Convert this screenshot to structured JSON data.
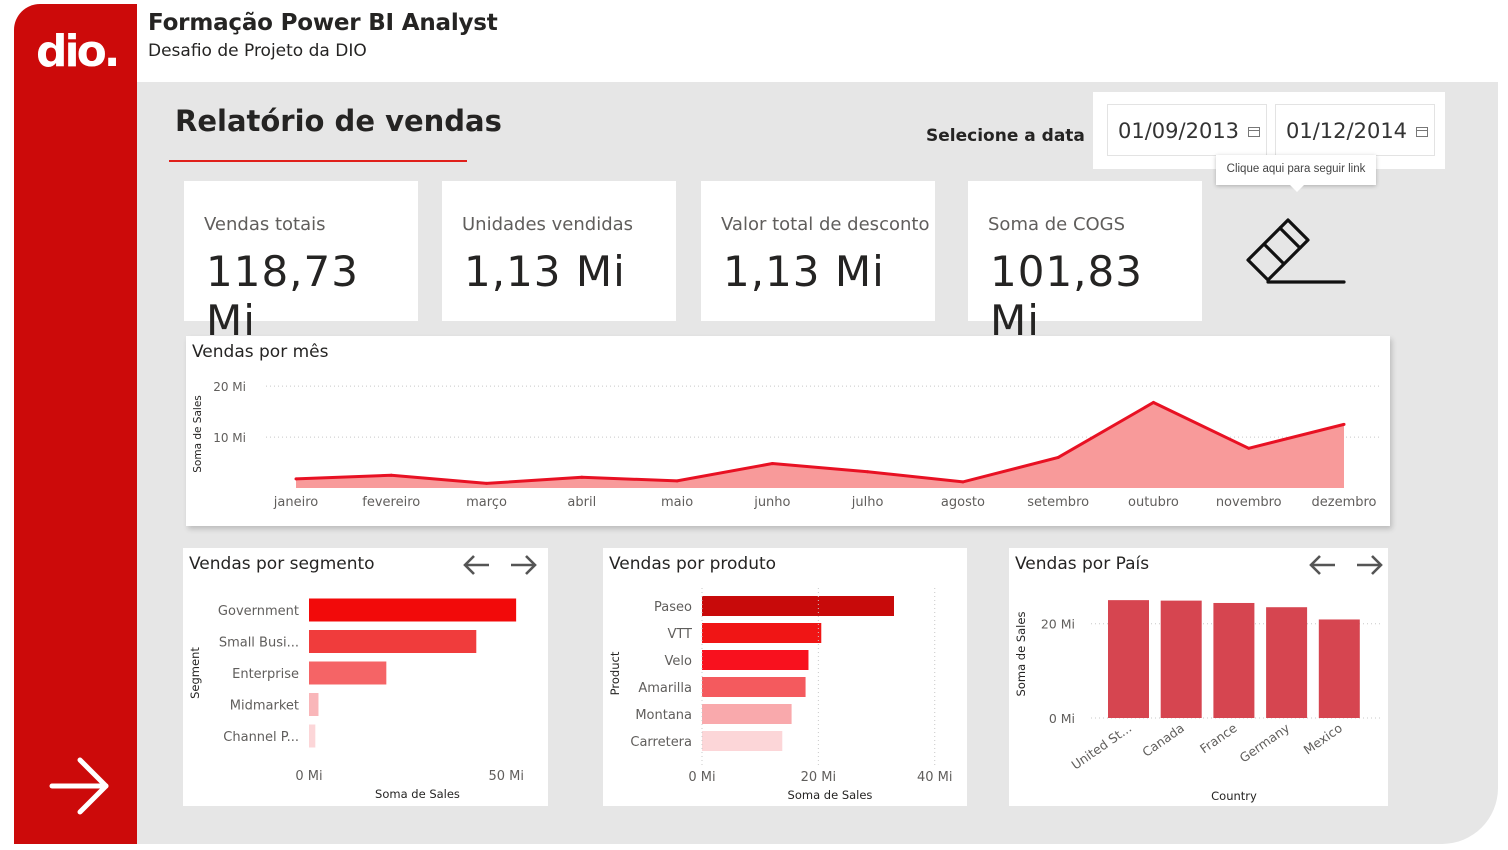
{
  "header": {
    "title": "Formação Power BI Analyst",
    "subtitle": "Desafio de Projeto da DIO",
    "logo_text": "dio."
  },
  "report": {
    "title": "Relatório de vendas",
    "date_label": "Selecione a data",
    "date_start": "01/09/2013",
    "date_end": "01/12/2014",
    "tooltip": "Clique aqui para seguir link"
  },
  "kpis": [
    {
      "label": "Vendas totais",
      "value": "118,73 Mi"
    },
    {
      "label": "Unidades vendidas",
      "value": "1,13 Mi"
    },
    {
      "label": "Valor total de desconto",
      "value": "1,13 Mi"
    },
    {
      "label": "Soma de COGS",
      "value": "101,83 Mi"
    }
  ],
  "icons": {
    "logo": "dio-logo-icon",
    "eraser": "eraser-icon",
    "next_page": "arrow-right-icon",
    "nav_prev": "arrow-left-icon",
    "nav_next": "arrow-right-icon",
    "calendar": "calendar-icon"
  },
  "colors": {
    "brand_red": "#cc0a0a",
    "area_fill": "#f89a9a",
    "line": "#e81123",
    "country_bar": "#d64550"
  },
  "chart_data": [
    {
      "type": "area",
      "title": "Vendas por mês",
      "ylabel": "Soma de Sales",
      "xlabel": "",
      "ylim": [
        0,
        22
      ],
      "yticks": [
        {
          "v": 10,
          "label": "10 Mi"
        },
        {
          "v": 20,
          "label": "20 Mi"
        }
      ],
      "categories": [
        "janeiro",
        "fevereiro",
        "março",
        "abril",
        "maio",
        "junho",
        "julho",
        "agosto",
        "setembro",
        "outubro",
        "novembro",
        "dezembro"
      ],
      "values": [
        1.8,
        2.5,
        0.9,
        2.1,
        1.4,
        4.8,
        3.2,
        1.2,
        6.0,
        16.8,
        7.8,
        12.5
      ],
      "grid": true
    },
    {
      "type": "bar",
      "orientation": "horizontal",
      "title": "Vendas por segmento",
      "ylabel": "Segment",
      "xlabel": "Soma de Sales",
      "xlim": [
        0,
        55
      ],
      "xticks": [
        {
          "v": 0,
          "label": "0 Mi"
        },
        {
          "v": 50,
          "label": "50 Mi"
        }
      ],
      "categories": [
        "Government",
        "Small Busi...",
        "Enterprise",
        "Midmarket",
        "Channel P..."
      ],
      "values": [
        52.5,
        42.4,
        19.6,
        2.4,
        1.6
      ],
      "colors": [
        "#f20a0a",
        "#f03c3c",
        "#f56466",
        "#f9b6b9",
        "#fcd6d8"
      ]
    },
    {
      "type": "bar",
      "orientation": "horizontal",
      "title": "Vendas por produto",
      "ylabel": "Product",
      "xlabel": "Soma de Sales",
      "xlim": [
        0,
        44
      ],
      "xticks": [
        {
          "v": 0,
          "label": "0 Mi"
        },
        {
          "v": 20,
          "label": "20 Mi"
        },
        {
          "v": 40,
          "label": "40 Mi"
        }
      ],
      "categories": [
        "Paseo",
        "VTT",
        "Velo",
        "Amarilla",
        "Montana",
        "Carretera"
      ],
      "values": [
        33.0,
        20.5,
        18.3,
        17.8,
        15.4,
        13.8
      ],
      "colors": [
        "#c80a0a",
        "#f01515",
        "#f8111e",
        "#f45a5e",
        "#f9a9ac",
        "#fcd6d8"
      ]
    },
    {
      "type": "bar",
      "orientation": "vertical",
      "title": "Vendas por País",
      "ylabel": "Soma de Sales",
      "xlabel": "Country",
      "ylim": [
        0,
        28
      ],
      "yticks": [
        {
          "v": 0,
          "label": "0 Mi"
        },
        {
          "v": 20,
          "label": "20 Mi"
        }
      ],
      "categories": [
        "United St...",
        "Canada",
        "France",
        "Germany",
        "Mexico"
      ],
      "values": [
        25.0,
        24.9,
        24.4,
        23.5,
        20.9
      ],
      "grid": true
    }
  ]
}
